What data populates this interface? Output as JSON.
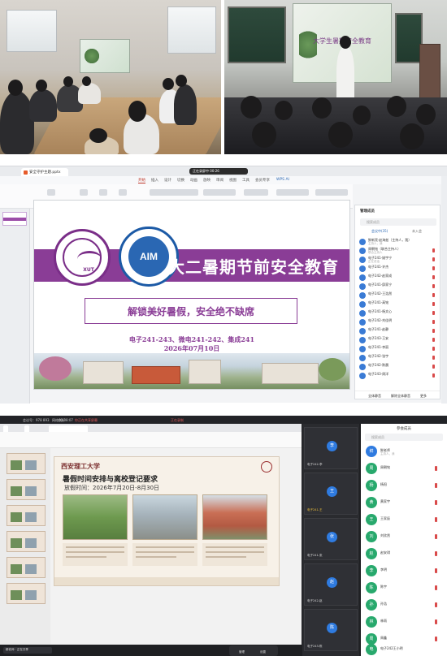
{
  "photo_left": {},
  "photo_right": {
    "screen_title": "大学生暑期安全教育"
  },
  "wps": {
    "file_tab": "安全守护主题.pptx",
    "recording_label": "正在录屏中 00:26",
    "ribbon_tabs": [
      "开始",
      "插入",
      "设计",
      "切换",
      "动画",
      "放映",
      "审阅",
      "视图",
      "工具",
      "会员专享",
      "WPS AI"
    ],
    "slide": {
      "logo1_abbr": "XUT",
      "logo2_abbr": "AIM",
      "title": "大二暑期节前安全教育",
      "subtitle": "解锁美好暑假，安全绝不缺席",
      "classes": "电子241-243、微电241-242、集成241",
      "date": "2026年07月10日"
    },
    "panel": {
      "title": "管理成员",
      "search_placeholder": "搜索成员",
      "tab_meeting": "会议中(35)",
      "tab_invite": "未入会",
      "members": [
        {
          "name": "鲜新亮·赵海兹（主持人，我）",
          "sub": "主持人，我"
        },
        {
          "name": "周朝铭（联合主持人）",
          "sub": "联合主持人"
        },
        {
          "name": "电子241-姚宇宁",
          "sub": "正在说话"
        },
        {
          "name": "电子241-许杰",
          "sub": ""
        },
        {
          "name": "电子242-赵家成",
          "sub": ""
        },
        {
          "name": "电子241-邱家宁",
          "sub": ""
        },
        {
          "name": "电子242-王浩然",
          "sub": ""
        },
        {
          "name": "电子241-高铭",
          "sub": ""
        },
        {
          "name": "电子241-杨文心",
          "sub": ""
        },
        {
          "name": "电子242-刘佳明",
          "sub": ""
        },
        {
          "name": "电子241-赵静",
          "sub": ""
        },
        {
          "name": "电子243-王安",
          "sub": ""
        },
        {
          "name": "电子241-李丽",
          "sub": ""
        },
        {
          "name": "电子242-张宇",
          "sub": ""
        },
        {
          "name": "电子242-陈晨",
          "sub": ""
        },
        {
          "name": "电子243-周洋",
          "sub": ""
        }
      ],
      "foot_mute": "全体静音",
      "foot_unmute": "解除全体静音",
      "foot_more": "更多"
    }
  },
  "meeting": {
    "top_bar": {
      "time": "00:08:07",
      "network": "网络良好",
      "id": "会议号：978 893",
      "sharing": "你正在共享屏幕",
      "recording": "正在录制"
    },
    "slide": {
      "school": "西安理工大学",
      "heading": "暑假时间安排与离校登记要求",
      "period": "放假时间：2026年7月20日-8月30日"
    },
    "tiles": [
      {
        "avatar": "李",
        "label": "电子242-李"
      },
      {
        "avatar": "王",
        "label": "电子241-王"
      },
      {
        "avatar": "张",
        "label": "电子241-张"
      },
      {
        "avatar": "赵",
        "label": "电子242-赵"
      },
      {
        "avatar": "陈",
        "label": "电子243-陈"
      }
    ],
    "members_title": "参会成员",
    "members_search": "搜索成员",
    "members": [
      {
        "avatar": "鲜",
        "name": "鲜老师",
        "sub": "主持人，我"
      },
      {
        "avatar": "周",
        "name": "周朝铭",
        "sub": ""
      },
      {
        "avatar": "杨",
        "name": "杨阳",
        "sub": ""
      },
      {
        "avatar": "黄",
        "name": "黄家宇",
        "sub": ""
      },
      {
        "avatar": "王",
        "name": "王家辰",
        "sub": ""
      },
      {
        "avatar": "刘",
        "name": "刘欣然",
        "sub": ""
      },
      {
        "avatar": "赵",
        "name": "赵安琪",
        "sub": ""
      },
      {
        "avatar": "李",
        "name": "李明",
        "sub": ""
      },
      {
        "avatar": "陈",
        "name": "陈宇",
        "sub": ""
      },
      {
        "avatar": "孙",
        "name": "孙浩",
        "sub": ""
      },
      {
        "avatar": "林",
        "name": "林雨",
        "sub": ""
      },
      {
        "avatar": "周",
        "name": "周鑫",
        "sub": ""
      },
      {
        "avatar": "电",
        "name": "电子242王小明",
        "sub": ""
      }
    ],
    "bottom_pill": "鲜老师 · 正在共享",
    "ctrl_left": "管理",
    "ctrl_right": "设置"
  }
}
